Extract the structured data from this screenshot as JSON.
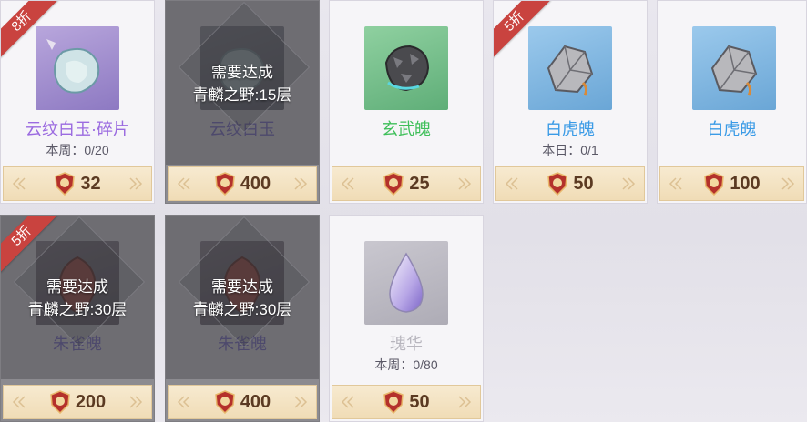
{
  "currency_icon": "fury-medal-icon",
  "colors": {
    "purple_name": "#9b6be0",
    "green_name": "#3fbf5a",
    "blue_name": "#3b9be6",
    "grey_name": "#b8b6be",
    "locked_name": "#544c86",
    "discount_ribbon": "#c9433f"
  },
  "items": [
    {
      "name": "云纹白玉·碎片",
      "limit": "本周：0/20",
      "price": "32",
      "discount": "8折",
      "lock": null,
      "icon": "white-jade-shard-icon"
    },
    {
      "name": "云纹白玉",
      "limit": "",
      "price": "400",
      "discount": "",
      "lock": {
        "line1": "需要达成",
        "line2": "青麟之野:15层"
      },
      "icon": "white-jade-icon"
    },
    {
      "name": "玄武魄",
      "limit": "",
      "price": "25",
      "discount": "",
      "lock": null,
      "icon": "xuanwu-soul-icon"
    },
    {
      "name": "白虎魄",
      "limit": "本日：0/1",
      "price": "50",
      "discount": "5折",
      "lock": null,
      "icon": "baihu-soul-icon"
    },
    {
      "name": "白虎魄",
      "limit": "",
      "price": "100",
      "discount": "",
      "lock": null,
      "icon": "baihu-soul-icon"
    },
    {
      "name": "朱雀魄",
      "limit": "",
      "price": "200",
      "discount": "5折",
      "lock": {
        "line1": "需要达成",
        "line2": "青麟之野:30层"
      },
      "icon": "zhuque-soul-icon"
    },
    {
      "name": "朱雀魄",
      "limit": "",
      "price": "400",
      "discount": "",
      "lock": {
        "line1": "需要达成",
        "line2": "青麟之野:30层"
      },
      "icon": "zhuque-soul-icon"
    },
    {
      "name": "瑰华",
      "limit": "本周：0/80",
      "price": "50",
      "discount": "",
      "lock": null,
      "icon": "essence-drop-icon"
    }
  ]
}
